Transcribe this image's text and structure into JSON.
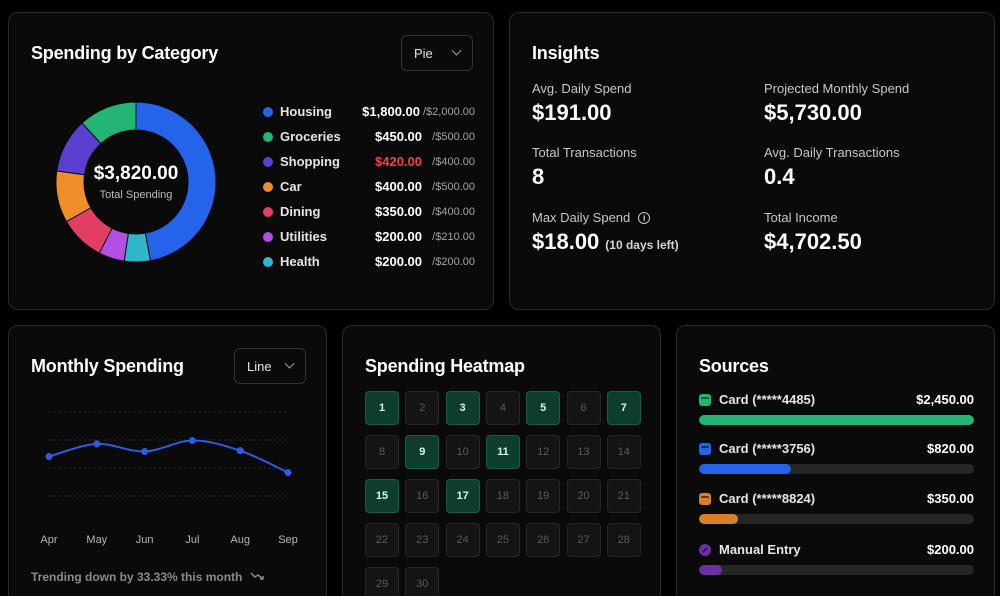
{
  "category_card": {
    "title": "Spending by Category",
    "chart_type_select": "Pie",
    "total": "$3,820.00",
    "total_caption": "Total Spending",
    "colors": {
      "over_budget": "#ef4444"
    }
  },
  "chart_data": [
    {
      "type": "pie",
      "categories": [
        "Housing",
        "Groceries",
        "Shopping",
        "Car",
        "Dining",
        "Utilities",
        "Health"
      ],
      "values": [
        1800,
        450,
        420,
        400,
        350,
        200,
        200
      ],
      "amount_labels": [
        "$1,800.00",
        "$450.00",
        "$420.00",
        "$400.00",
        "$350.00",
        "$200.00",
        "$200.00"
      ],
      "budget_labels": [
        "/$2,000.00",
        "/$500.00",
        "/$400.00",
        "/$500.00",
        "/$400.00",
        "/$210.00",
        "/$200.00"
      ],
      "over_budget": [
        false,
        false,
        true,
        false,
        false,
        false,
        false
      ],
      "colors": [
        "#2563eb",
        "#22b573",
        "#5b3fd1",
        "#ef8d2a",
        "#e23e64",
        "#b14fe0",
        "#2fb6c9"
      ],
      "slice_order": [
        "Housing",
        "Health",
        "Utilities",
        "Dining",
        "Car",
        "Shopping",
        "Groceries"
      ]
    },
    {
      "type": "line",
      "x": [
        "Apr",
        "May",
        "Jun",
        "Jul",
        "Aug",
        "Sep"
      ],
      "series": [
        {
          "values": [
            47,
            62,
            53,
            66,
            54,
            28
          ],
          "color": "#2d5be3"
        }
      ],
      "ylim": [
        0,
        100
      ],
      "grid": true
    }
  ],
  "insights": {
    "title": "Insights",
    "items": [
      {
        "label": "Avg. Daily Spend",
        "value": "$191.00"
      },
      {
        "label": "Projected Monthly Spend",
        "value": "$5,730.00"
      },
      {
        "label": "Total Transactions",
        "value": "8"
      },
      {
        "label": "Avg. Daily Transactions",
        "value": "0.4"
      },
      {
        "label": "Max Daily Spend",
        "value": "$18.00",
        "note": "(10 days left)",
        "icon": "info-icon"
      },
      {
        "label": "Total Income",
        "value": "$4,702.50"
      }
    ]
  },
  "monthly": {
    "title": "Monthly Spending",
    "chart_type_select": "Line",
    "trend_text": "Trending down by 33.33% this month",
    "trend_icon": "trending-down-icon"
  },
  "heatmap": {
    "title": "Spending Heatmap",
    "days": [
      "1",
      "2",
      "3",
      "4",
      "5",
      "6",
      "7",
      "8",
      "9",
      "10",
      "11",
      "12",
      "13",
      "14",
      "15",
      "16",
      "17",
      "18",
      "19",
      "20",
      "21",
      "22",
      "23",
      "24",
      "25",
      "26",
      "27",
      "28",
      "29",
      "30"
    ],
    "active": [
      1,
      3,
      5,
      7,
      9,
      11,
      15,
      17
    ],
    "colors": {
      "active_bg": "#0d3d2c",
      "inactive_bg": "#141414"
    }
  },
  "sources": {
    "title": "Sources",
    "items": [
      {
        "name": "Card (*****4485)",
        "amount": "$2,450.00",
        "fraction": 1.0,
        "color": "#22b573",
        "icon": "card-icon"
      },
      {
        "name": "Card (*****3756)",
        "amount": "$820.00",
        "fraction": 0.335,
        "color": "#2563eb",
        "icon": "card-icon"
      },
      {
        "name": "Card (*****8824)",
        "amount": "$350.00",
        "fraction": 0.143,
        "color": "#d97f2a",
        "icon": "card-icon"
      },
      {
        "name": "Manual Entry",
        "amount": "$200.00",
        "fraction": 0.082,
        "color": "#6b2fa8",
        "icon": "pencil-icon"
      }
    ]
  }
}
